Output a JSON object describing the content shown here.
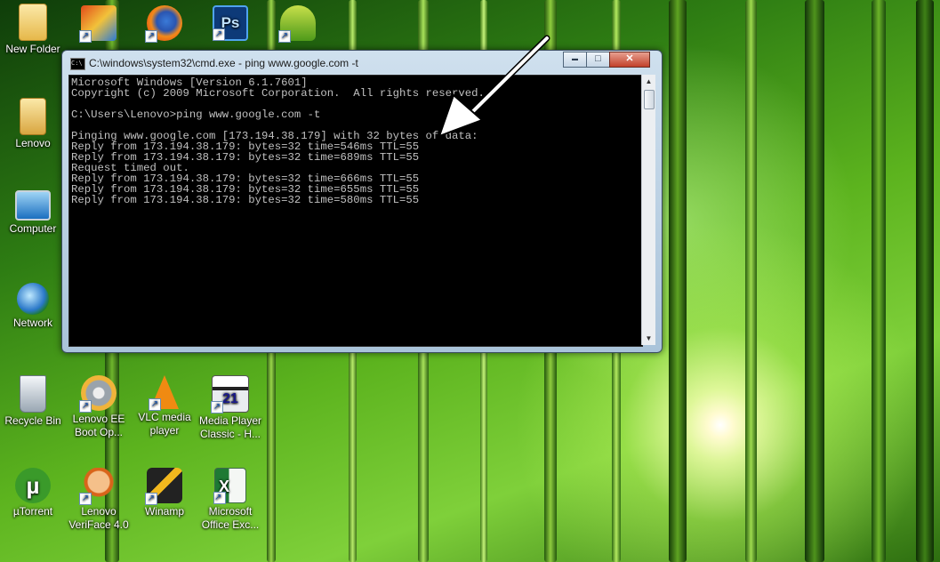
{
  "window": {
    "title": "C:\\windows\\system32\\cmd.exe - ping  www.google.com -t",
    "buttons": {
      "minimize": "▬",
      "maximize": "□",
      "close": "✕"
    },
    "console_lines": [
      "Microsoft Windows [Version 6.1.7601]",
      "Copyright (c) 2009 Microsoft Corporation.  All rights reserved.",
      "",
      "C:\\Users\\Lenovo>ping www.google.com -t",
      "",
      "Pinging www.google.com [173.194.38.179] with 32 bytes of data:",
      "Reply from 173.194.38.179: bytes=32 time=546ms TTL=55",
      "Reply from 173.194.38.179: bytes=32 time=689ms TTL=55",
      "Request timed out.",
      "Reply from 173.194.38.179: bytes=32 time=666ms TTL=55",
      "Reply from 173.194.38.179: bytes=32 time=655ms TTL=55",
      "Reply from 173.194.38.179: bytes=32 time=580ms TTL=55"
    ]
  },
  "desktop_icons": [
    {
      "label": "New Folder"
    },
    {
      "label": "Lenovo"
    },
    {
      "label": "Computer"
    },
    {
      "label": "Network"
    },
    {
      "label": "Recycle Bin"
    },
    {
      "label": "Lenovo EE Boot Op..."
    },
    {
      "label": "VLC media player"
    },
    {
      "label": "Media Player Classic - H..."
    },
    {
      "label": "µTorrent"
    },
    {
      "label": "Lenovo VeriFace 4.0"
    },
    {
      "label": "Winamp"
    },
    {
      "label": "Microsoft Office Exc..."
    }
  ],
  "colors": {
    "console_bg": "#000000",
    "console_text": "#c0c0c0",
    "arrow": "#ffffff"
  }
}
